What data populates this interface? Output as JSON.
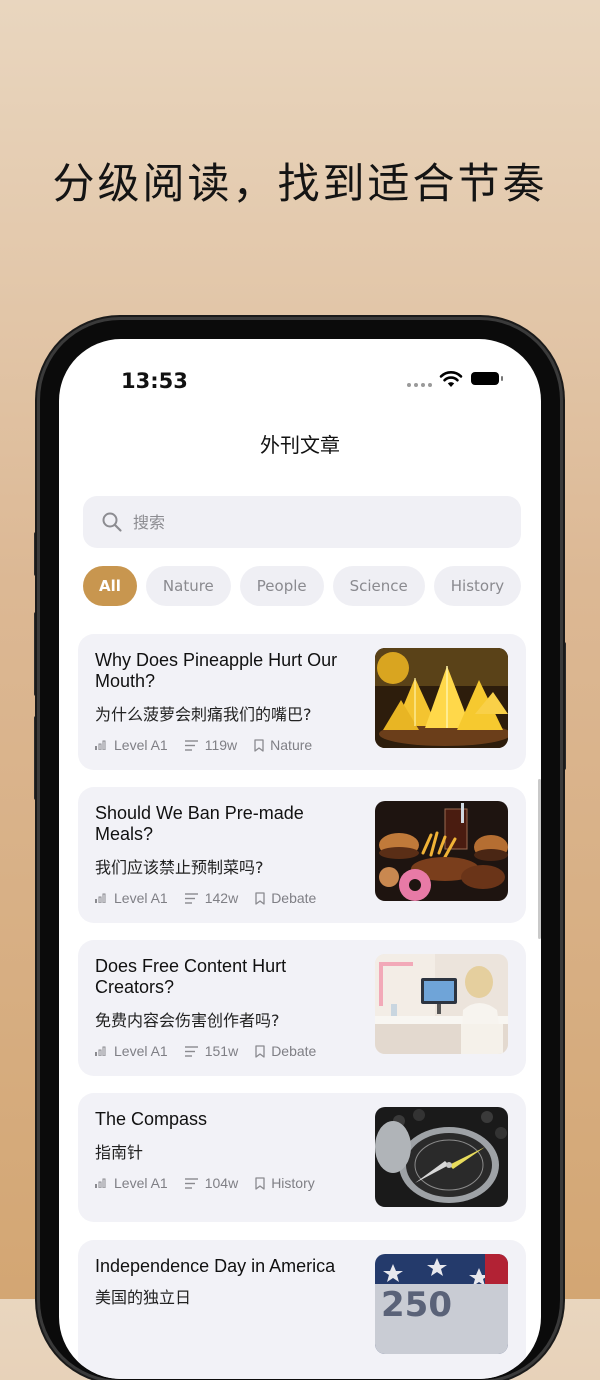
{
  "headline": "分级阅读，找到适合节奏",
  "status": {
    "time": "13:53"
  },
  "nav": {
    "title": "外刊文章"
  },
  "search": {
    "placeholder": "搜索"
  },
  "categories": [
    "All",
    "Nature",
    "People",
    "Science",
    "History"
  ],
  "active_category": "All",
  "articles": [
    {
      "title": "Why Does Pineapple Hurt Our Mouth?",
      "subtitle": "为什么菠萝会刺痛我们的嘴巴?",
      "level": "Level A1",
      "words": "119w",
      "tag": "Nature",
      "image": "pineapple-image"
    },
    {
      "title": "Should We Ban Pre-made Meals?",
      "subtitle": "我们应该禁止预制菜吗?",
      "level": "Level A1",
      "words": "142w",
      "tag": "Debate",
      "image": "fast-food-image"
    },
    {
      "title": "Does Free Content Hurt Creators?",
      "subtitle": "免费内容会伤害创作者吗?",
      "level": "Level A1",
      "words": "151w",
      "tag": "Debate",
      "image": "creator-desk-image"
    },
    {
      "title": "The Compass",
      "subtitle": "指南针",
      "level": "Level A1",
      "words": "104w",
      "tag": "History",
      "image": "compass-image"
    },
    {
      "title": "Independence Day in America",
      "subtitle": "美国的独立日",
      "level": "",
      "words": "",
      "tag": "",
      "image": "american-flag-image"
    }
  ],
  "colors": {
    "accent": "#c8964f",
    "card_bg": "#f2f2f7",
    "page_bg_top": "#e9d6bf",
    "page_bg_bottom": "#d3a673"
  }
}
